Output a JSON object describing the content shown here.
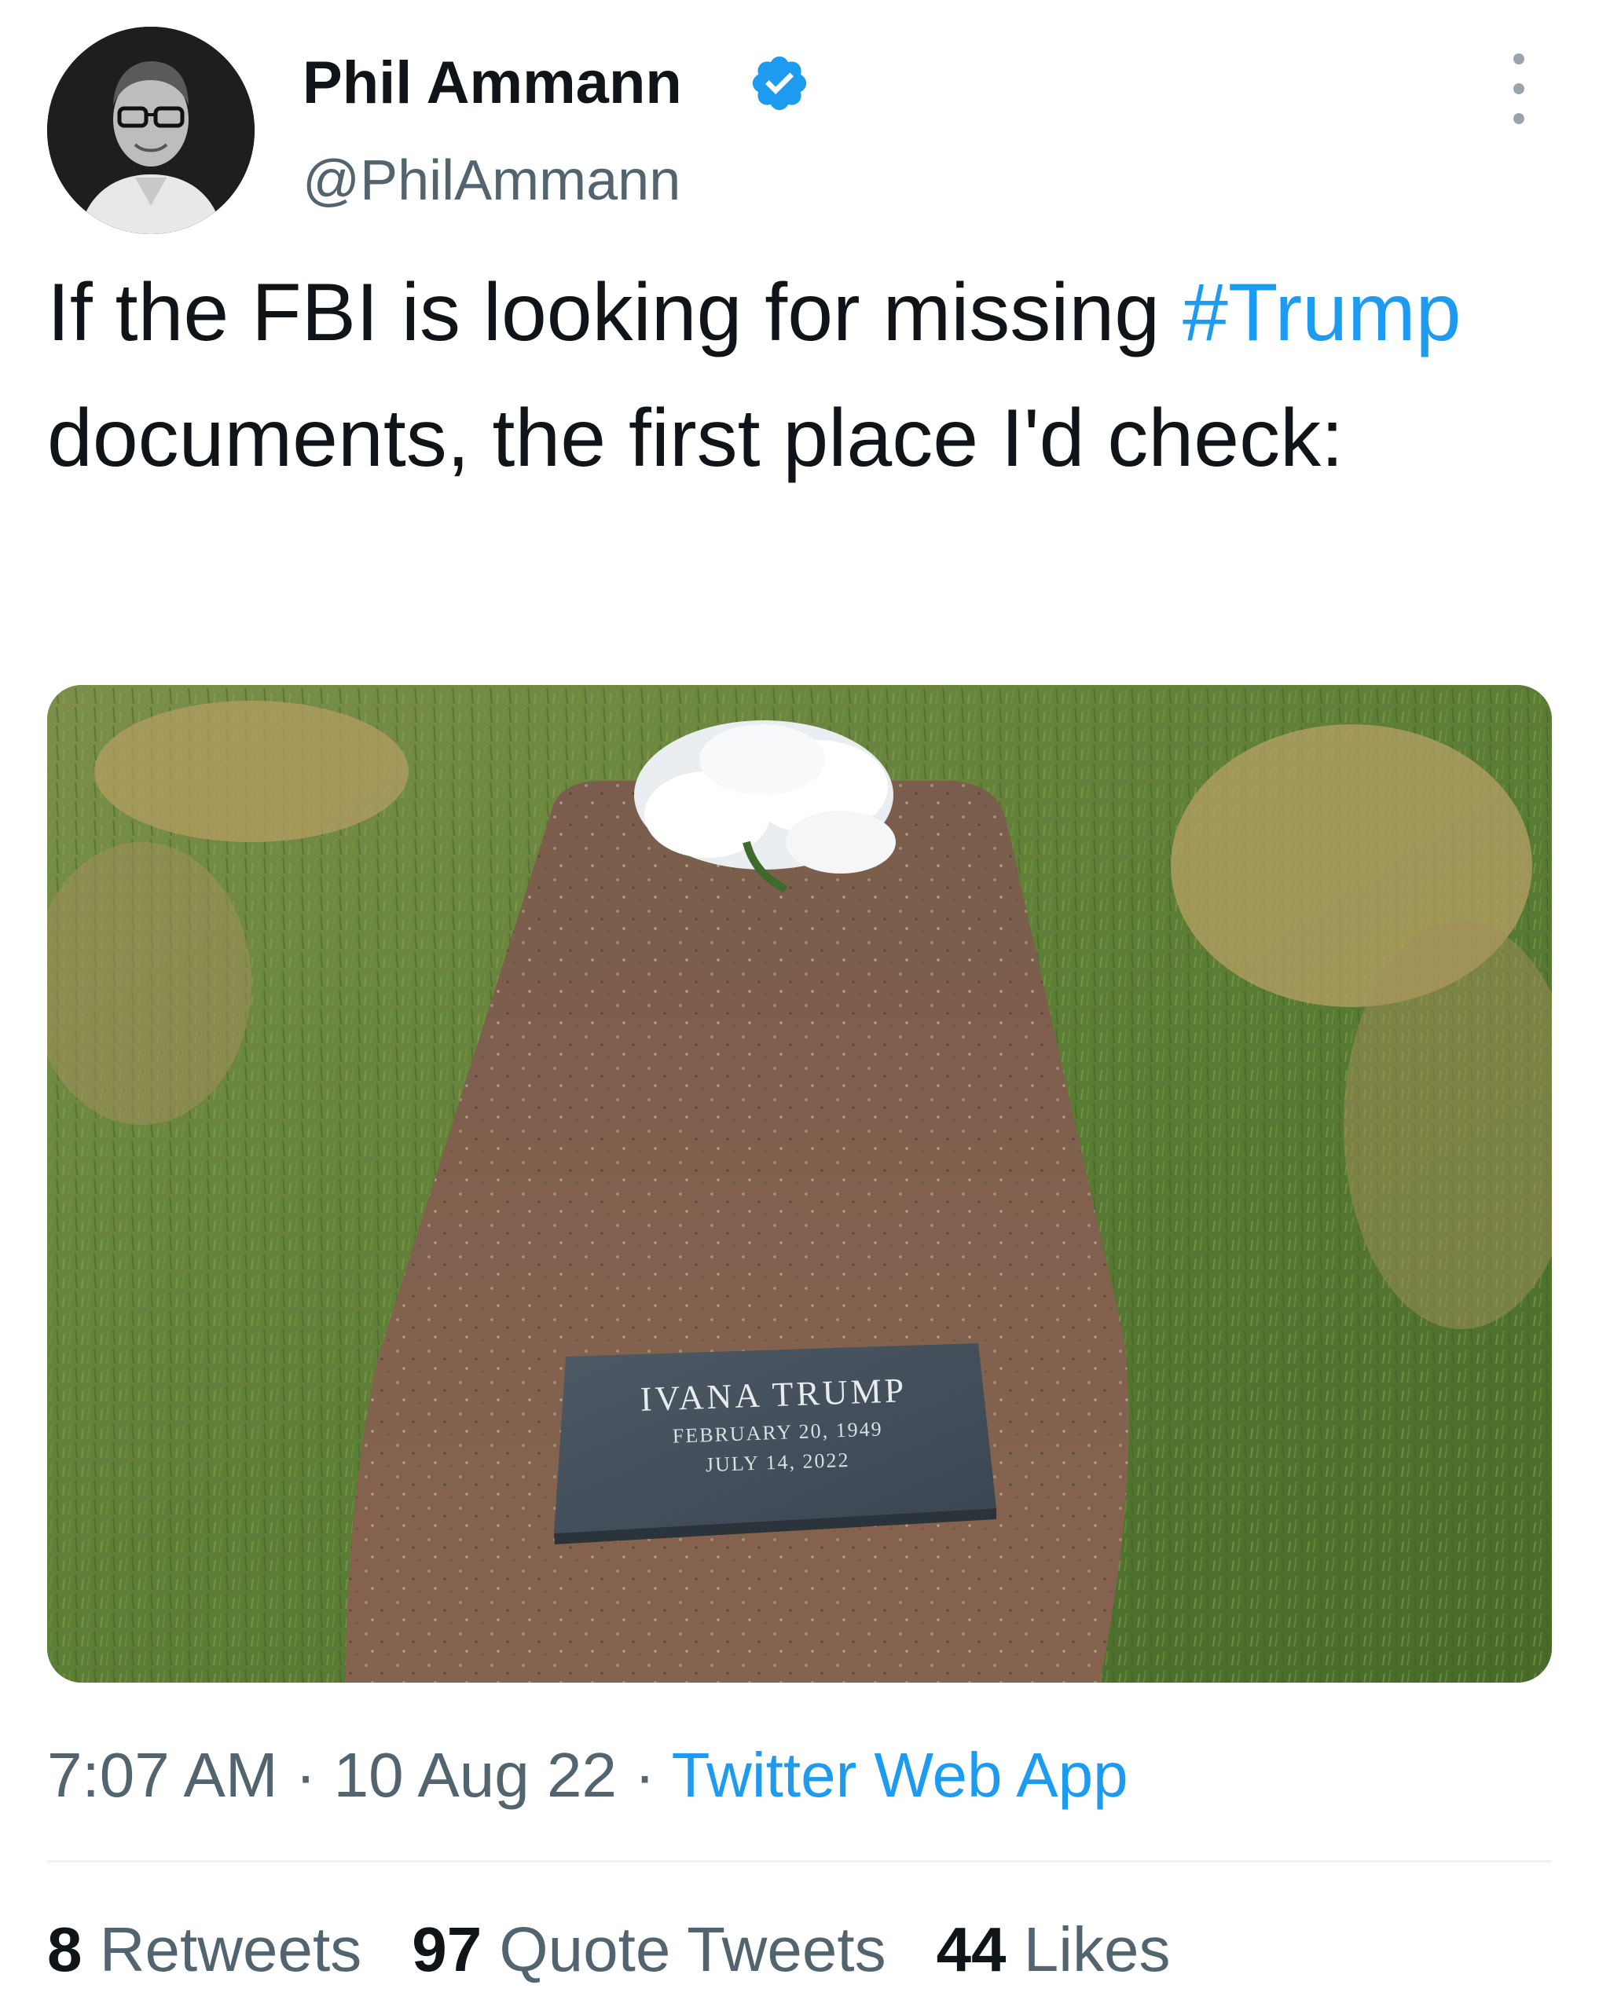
{
  "author": {
    "display_name": "Phil Ammann",
    "handle": "@PhilAmmann",
    "verified": true,
    "avatar_icon": "avatar-photo"
  },
  "tweet": {
    "text_before_hashtag": "If the FBI is looking for missing ",
    "hashtag": "#Trump",
    "text_after_hashtag": " documents, the first place I'd check:"
  },
  "media": {
    "headstone": {
      "name": "IVANA TRUMP",
      "birth": "FEBRUARY 20, 1949",
      "death": "JULY 14, 2022"
    }
  },
  "meta": {
    "time": "7:07 AM",
    "separator": " · ",
    "date": "10 Aug 22",
    "source": "Twitter Web App"
  },
  "stats": {
    "retweets_count": "8",
    "retweets_label": " Retweets",
    "quotes_count": "97",
    "quotes_label": " Quote Tweets",
    "likes_count": "44",
    "likes_label": " Likes"
  },
  "colors": {
    "link": "#1d9bf0",
    "secondary_text": "#536471",
    "primary_text": "#0f1419",
    "verified_badge": "#1d9bf0"
  }
}
